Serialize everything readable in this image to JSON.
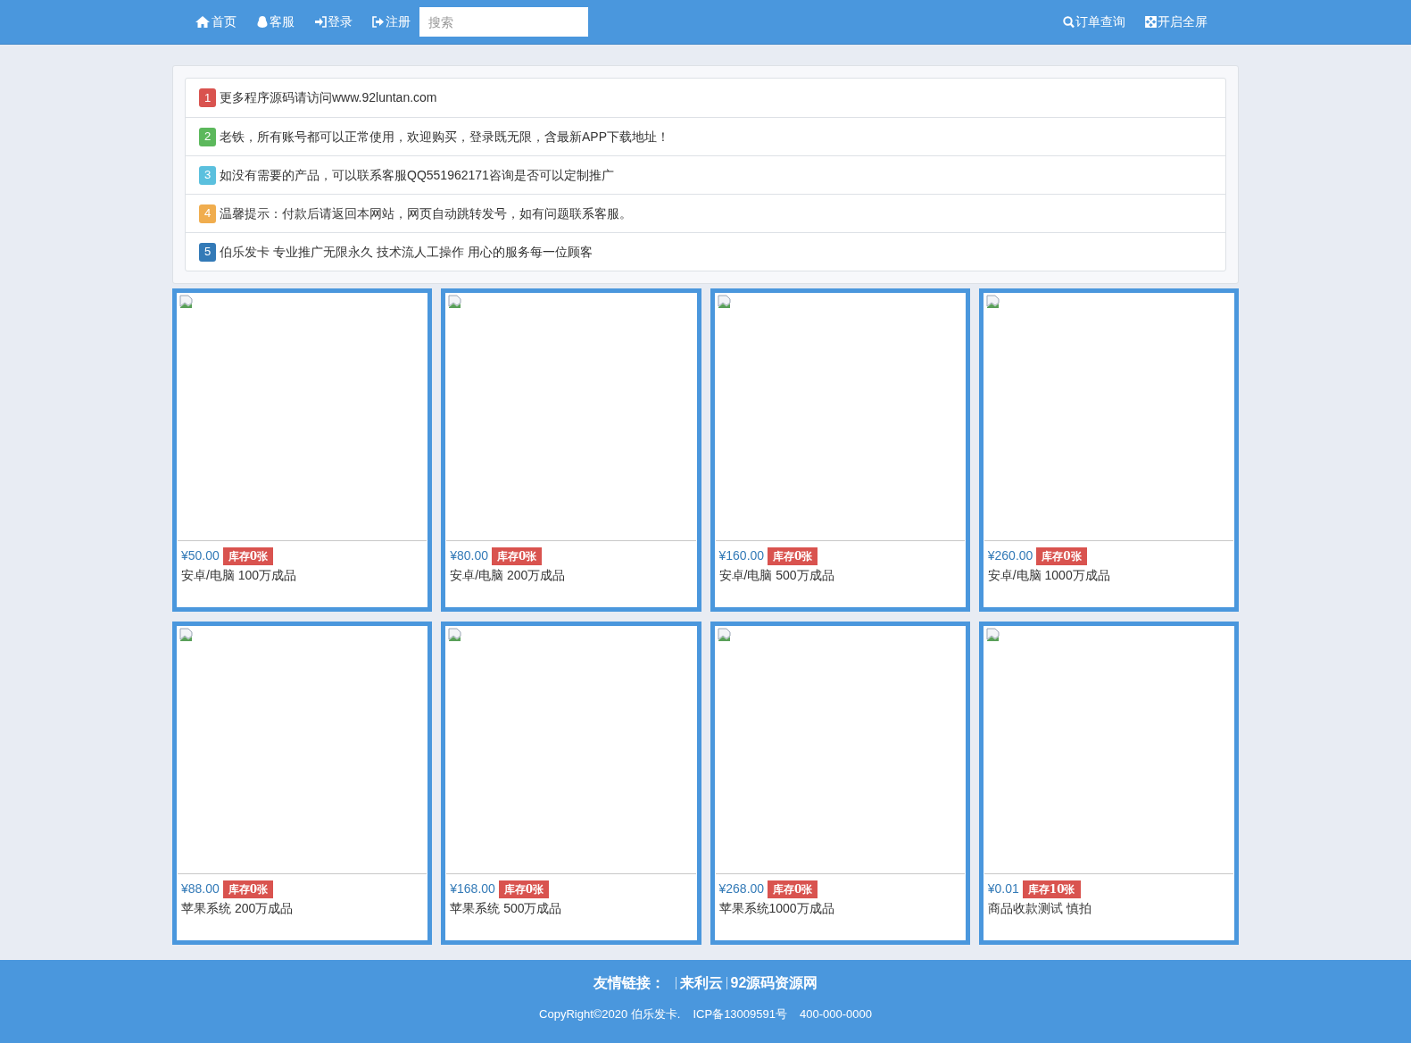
{
  "navbar": {
    "left_links": [
      {
        "kind": "home",
        "label": "首页"
      },
      {
        "kind": "service",
        "label": "客服"
      },
      {
        "kind": "login",
        "label": "登录"
      },
      {
        "kind": "register",
        "label": "注册"
      }
    ],
    "search": {
      "placeholder": "搜索"
    },
    "right_links": [
      {
        "kind": "search",
        "label": "订单查询"
      },
      {
        "kind": "fullscreen",
        "label": "开启全屏"
      }
    ]
  },
  "notices": [
    {
      "number": "1",
      "color": "#d9534f",
      "text": "更多程序源码请访问www.92luntan.com"
    },
    {
      "number": "2",
      "color": "#5cb85c",
      "text": "老铁，所有账号都可以正常使用，欢迎购买，登录既无限，含最新APP下载地址！"
    },
    {
      "number": "3",
      "color": "#5bc0de",
      "text": "如没有需要的产品，可以联系客服QQ551962171咨询是否可以定制推广"
    },
    {
      "number": "4",
      "color": "#f0ad4e",
      "text": "温馨提示：付款后请返回本网站，网页自动跳转发号，如有问题联系客服。"
    },
    {
      "number": "5",
      "color": "#337ab7",
      "text": "伯乐发卡 专业推广无限永久 技术流人工操作 用心的服务每一位顾客"
    }
  ],
  "products": [
    {
      "price": "¥50.00",
      "stock": "库存0张",
      "name": "安卓/电脑 100万成品"
    },
    {
      "price": "¥80.00",
      "stock": "库存0张",
      "name": "安卓/电脑 200万成品"
    },
    {
      "price": "¥160.00",
      "stock": "库存0张",
      "name": "安卓/电脑 500万成品"
    },
    {
      "price": "¥260.00",
      "stock": "库存0张",
      "name": "安卓/电脑 1000万成品"
    },
    {
      "price": "¥88.00",
      "stock": "库存0张",
      "name": "苹果系统 200万成品"
    },
    {
      "price": "¥168.00",
      "stock": "库存0张",
      "name": "苹果系统 500万成品"
    },
    {
      "price": "¥268.00",
      "stock": "库存0张",
      "name": "苹果系统1000万成品"
    },
    {
      "price": "¥0.01",
      "stock": "库存10张",
      "name": "商品收款测试 慎拍"
    }
  ],
  "footer": {
    "links_label": "友情链接：",
    "links": [
      "来利云",
      "92源码资源网"
    ],
    "copyright": "CopyRight©2020 伯乐发卡.",
    "icp": "ICP备13009591号",
    "phone": "400-000-0000"
  }
}
